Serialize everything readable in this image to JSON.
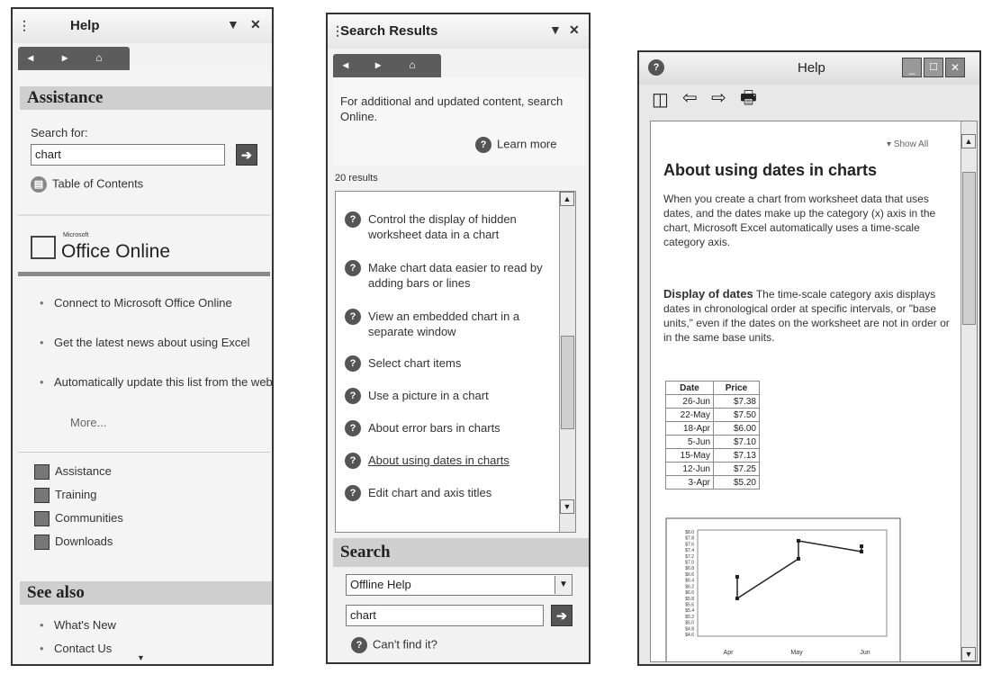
{
  "help_pane": {
    "title": "Help",
    "assistance_header": "Assistance",
    "search_for_label": "Search for:",
    "search_value": "chart",
    "table_of_contents": "Table of Contents",
    "office_online_small": "Microsoft",
    "office_online": "Office Online",
    "online_links": [
      "Connect to Microsoft Office Online",
      "Get the latest news about using Excel",
      "Automatically update this list from the web"
    ],
    "more_link": "More...",
    "nav_links": [
      "Assistance",
      "Training",
      "Communities",
      "Downloads"
    ],
    "see_also_header": "See also",
    "see_also_links": [
      "What's New",
      "Contact Us"
    ]
  },
  "results_pane": {
    "title": "Search Results",
    "online_note": "For additional and updated content, search Online.",
    "learn_more": "Learn more",
    "result_count": "20 results",
    "results": [
      "Control the display of hidden worksheet data in a chart",
      "Make chart data easier to read by adding bars or lines",
      "View an embedded chart in a separate window",
      "Select chart items",
      "Use a picture in a chart",
      "About error bars in charts",
      "About using dates in charts",
      "Edit chart and axis titles"
    ],
    "search_header": "Search",
    "scope_value": "Offline Help",
    "search_value": "chart",
    "cant_find": "Can't find it?"
  },
  "help_window": {
    "title": "Help",
    "show_all": "Show All",
    "heading": "About using dates in charts",
    "intro": "When you create a chart from worksheet data that uses dates, and the dates make up the category (x) axis in the chart, Microsoft Excel automatically uses a time-scale category axis.",
    "subheading": "Display of dates",
    "body": "The time-scale category axis displays dates in chronological order at specific intervals, or \"base units,\" even if the dates on the worksheet are not in order or in the same base units.",
    "table_headers": [
      "Date",
      "Price"
    ],
    "table_rows": [
      [
        "26-Jun",
        "$7.38"
      ],
      [
        "22-May",
        "$7.50"
      ],
      [
        "18-Apr",
        "$6.00"
      ],
      [
        "5-Jun",
        "$7.10"
      ],
      [
        "15-May",
        "$7.13"
      ],
      [
        "12-Jun",
        "$7.25"
      ],
      [
        "3-Apr",
        "$5.20"
      ]
    ],
    "chart_ticks_y": [
      "$8.0",
      "$7.8",
      "$7.6",
      "$7.4",
      "$7.2",
      "$7.0",
      "$6.8",
      "$6.6",
      "$6.4",
      "$6.2",
      "$6.0",
      "$5.8",
      "$5.6",
      "$5.4",
      "$5.2",
      "$5.0",
      "$4.8",
      "$4.6"
    ],
    "chart_ticks_x": [
      "Apr",
      "May",
      "Jun"
    ]
  }
}
